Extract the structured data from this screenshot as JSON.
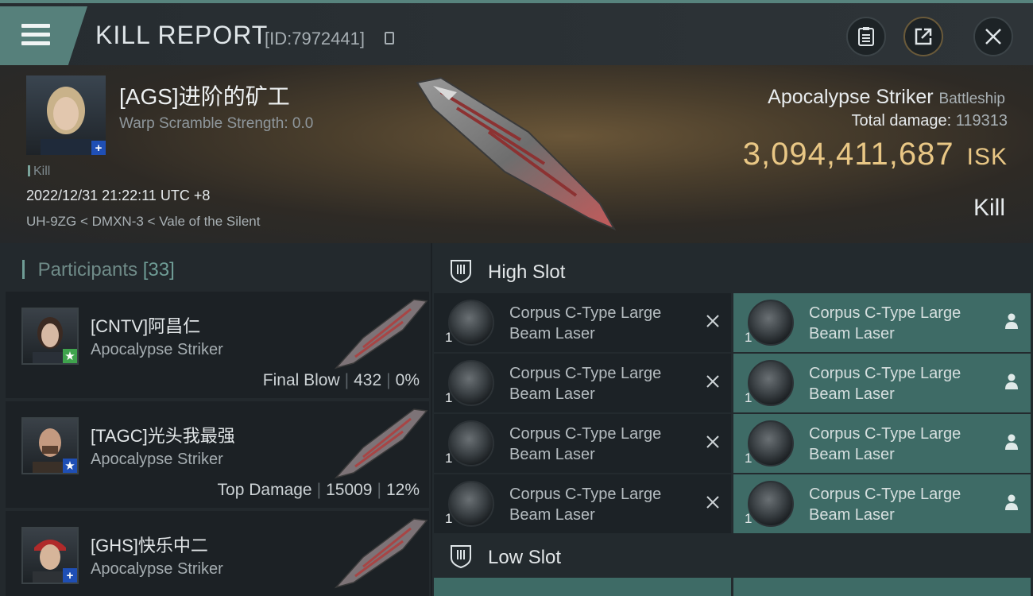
{
  "header": {
    "title": "KILL REPORT",
    "kill_id": "[ID:7972441]",
    "buttons": [
      "clipboard-icon",
      "share-icon",
      "close-icon"
    ]
  },
  "victim": {
    "name": "[AGS]进阶的矿工",
    "warp_scramble": "Warp Scramble Strength: 0.0",
    "tag": "Kill",
    "datetime": "2022/12/31 21:22:11 UTC +8",
    "location": "UH-9ZG < DMXN-3 < Vale of the Silent",
    "ship": "Apocalypse Striker",
    "ship_class": "Battleship",
    "total_damage_label": "Total damage:",
    "total_damage": "119313",
    "isk_value": "3,094,411,687",
    "isk_unit": "ISK",
    "result": "Kill"
  },
  "participants": {
    "label": "Participants",
    "count": "[33]",
    "items": [
      {
        "name": "[CNTV]阿昌仁",
        "ship": "Apocalypse Striker",
        "stat_label": "Final Blow",
        "damage": "432",
        "percent": "0%",
        "badge": "star",
        "badge_color": "#3fa34d"
      },
      {
        "name": "[TAGC]光头我最强",
        "ship": "Apocalypse Striker",
        "stat_label": "Top Damage",
        "damage": "15009",
        "percent": "12%",
        "badge": "star",
        "badge_color": "#1f4fb5"
      },
      {
        "name": "[GHS]快乐中二",
        "ship": "Apocalypse Striker",
        "stat_label": "",
        "damage": "",
        "percent": "",
        "badge": "plus",
        "badge_color": "#1f4fb5"
      }
    ]
  },
  "slots": {
    "high": {
      "label": "High Slot",
      "destroyed": [
        {
          "name": "Corpus C-Type Large Beam Laser",
          "qty": "1"
        },
        {
          "name": "Corpus C-Type Large Beam Laser",
          "qty": "1"
        },
        {
          "name": "Corpus C-Type Large Beam Laser",
          "qty": "1"
        },
        {
          "name": "Corpus C-Type Large Beam Laser",
          "qty": "1"
        }
      ],
      "dropped": [
        {
          "name": "Corpus C-Type Large Beam Laser",
          "qty": "1"
        },
        {
          "name": "Corpus C-Type Large Beam Laser",
          "qty": "1"
        },
        {
          "name": "Corpus C-Type Large Beam Laser",
          "qty": "1"
        },
        {
          "name": "Corpus C-Type Large Beam Laser",
          "qty": "1"
        }
      ]
    },
    "low": {
      "label": "Low Slot"
    }
  },
  "colors": {
    "accent": "#56807b",
    "isk": "#e9c785",
    "dropped": "#3e6b66"
  }
}
